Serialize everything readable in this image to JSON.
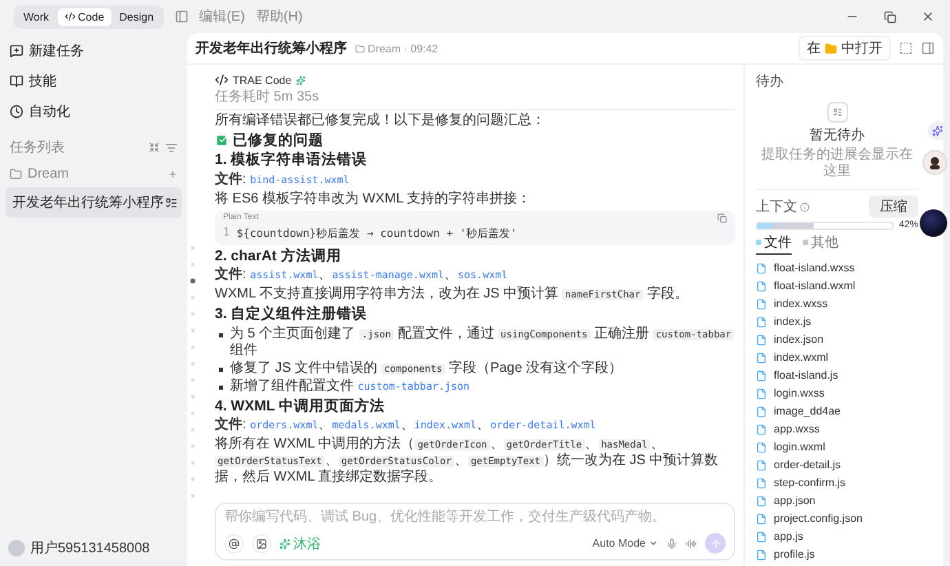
{
  "top_bar": {
    "modes": [
      {
        "label": "Work",
        "selected": false
      },
      {
        "label": "Code",
        "selected": true
      },
      {
        "label": "Design",
        "selected": false
      }
    ],
    "menus": [
      "编辑(E)",
      "帮助(H)"
    ]
  },
  "sidebar": {
    "items": [
      {
        "label": "新建任务",
        "kind": "new"
      },
      {
        "label": "技能",
        "kind": "skills"
      },
      {
        "label": "自动化",
        "kind": "auto"
      }
    ],
    "section_title": "任务列表",
    "folder": "Dream",
    "tasks": [
      {
        "label": "开发老年出行统筹小程序",
        "selected": true
      }
    ],
    "user": "用户595131458008"
  },
  "header": {
    "title": "开发老年出行统筹小程序",
    "meta": "Dream · 09:42",
    "open_prefix": "在",
    "open_label": "中打开"
  },
  "chat": {
    "agent": "TRAE Code",
    "duration": "任务耗时 5m 35s",
    "intro": "所有编译错误都已修复完成！以下是修复的问题汇总：",
    "summary_title": "已修复的问题",
    "sections": [
      {
        "heading": "1. 模板字符串语法错误",
        "files": [
          {
            "kind": "label",
            "text": "文件"
          },
          {
            "kind": "text",
            "text": ": "
          },
          {
            "kind": "link",
            "text": "bind-assist.wxml"
          }
        ],
        "desc": [
          {
            "kind": "text",
            "text": "将 ES6 模板字符串改为 WXML 支持的字符串拼接："
          }
        ],
        "code": {
          "lang": "Plain Text",
          "line": "1",
          "text": "${countdown}秒后盖发 → countdown + '秒后盖发'"
        }
      },
      {
        "heading": "2. charAt 方法调用",
        "files": [
          {
            "kind": "label",
            "text": "文件"
          },
          {
            "kind": "text",
            "text": ": "
          },
          {
            "kind": "link",
            "text": "assist.wxml"
          },
          {
            "kind": "text",
            "text": "、"
          },
          {
            "kind": "link",
            "text": "assist-manage.wxml"
          },
          {
            "kind": "text",
            "text": "、"
          },
          {
            "kind": "link",
            "text": "sos.wxml"
          }
        ],
        "desc": [
          {
            "kind": "text",
            "text": "WXML 不支持直接调用字符串方法，改为在 JS 中预计算 "
          },
          {
            "kind": "code",
            "text": "nameFirstChar"
          },
          {
            "kind": "text",
            "text": " 字段。"
          }
        ]
      },
      {
        "heading": "3. 自定义组件注册错误",
        "bullets": [
          [
            {
              "kind": "text",
              "text": "为 5 个主页面创建了 "
            },
            {
              "kind": "code",
              "text": ".json"
            },
            {
              "kind": "text",
              "text": " 配置文件，通过 "
            },
            {
              "kind": "code",
              "text": "usingComponents"
            },
            {
              "kind": "text",
              "text": " 正确注册 "
            },
            {
              "kind": "code",
              "text": "custom-tabbar"
            },
            {
              "kind": "text",
              "text": " 组件"
            }
          ],
          [
            {
              "kind": "text",
              "text": "修复了 JS 文件中错误的 "
            },
            {
              "kind": "code",
              "text": "components"
            },
            {
              "kind": "text",
              "text": " 字段（Page 没有这个字段）"
            }
          ],
          [
            {
              "kind": "text",
              "text": "新增了组件配置文件 "
            },
            {
              "kind": "link",
              "text": "custom-tabbar.json"
            }
          ]
        ]
      },
      {
        "heading": "4. WXML 中调用页面方法",
        "files": [
          {
            "kind": "label",
            "text": "文件"
          },
          {
            "kind": "text",
            "text": ": "
          },
          {
            "kind": "link",
            "text": "orders.wxml"
          },
          {
            "kind": "text",
            "text": "、"
          },
          {
            "kind": "link",
            "text": "medals.wxml"
          },
          {
            "kind": "text",
            "text": "、"
          },
          {
            "kind": "link",
            "text": "index.wxml"
          },
          {
            "kind": "text",
            "text": "、"
          },
          {
            "kind": "link",
            "text": "order-detail.wxml"
          }
        ],
        "desc": [
          {
            "kind": "text",
            "text": "将所有在 WXML 中调用的方法（"
          },
          {
            "kind": "code",
            "text": "getOrderIcon"
          },
          {
            "kind": "text",
            "text": "、"
          },
          {
            "kind": "code",
            "text": "getOrderTitle"
          },
          {
            "kind": "text",
            "text": "、"
          },
          {
            "kind": "code",
            "text": "hasMedal"
          },
          {
            "kind": "text",
            "text": "、"
          },
          {
            "kind": "code",
            "text": "getOrderStatusText"
          },
          {
            "kind": "text",
            "text": "、"
          },
          {
            "kind": "code",
            "text": "getOrderStatusColor"
          },
          {
            "kind": "text",
            "text": "、"
          },
          {
            "kind": "code",
            "text": "getEmptyText"
          },
          {
            "kind": "text",
            "text": "）统一改为在 JS 中预计算数据，然后 WXML 直接绑定数据字段。"
          }
        ]
      }
    ],
    "input": {
      "placeholder": "帮你编写代码、调试 Bug、优化性能等开发工作，交付生产级代码产物。",
      "chip": "沐浴",
      "mode": "Auto Mode"
    }
  },
  "right_panel": {
    "todo_title": "待办",
    "empty_title": "暂无待办",
    "empty_hint": "提取任务的进展会显示在这里",
    "context_title": "上下文",
    "compress": "压缩",
    "context": {
      "level": 0.42,
      "reading": "42%"
    },
    "tabs": [
      {
        "label": "文件",
        "selected": true
      },
      {
        "label": "其他",
        "selected": false
      }
    ],
    "files": [
      "float-island.wxss",
      "float-island.wxml",
      "index.wxss",
      "index.js",
      "index.json",
      "index.wxml",
      "float-island.js",
      "login.wxss",
      "image_dd4ae",
      "app.wxss",
      "login.wxml",
      "order-detail.js",
      "step-confirm.js",
      "app.json",
      "project.config.json",
      "app.js",
      "profile.js"
    ]
  }
}
